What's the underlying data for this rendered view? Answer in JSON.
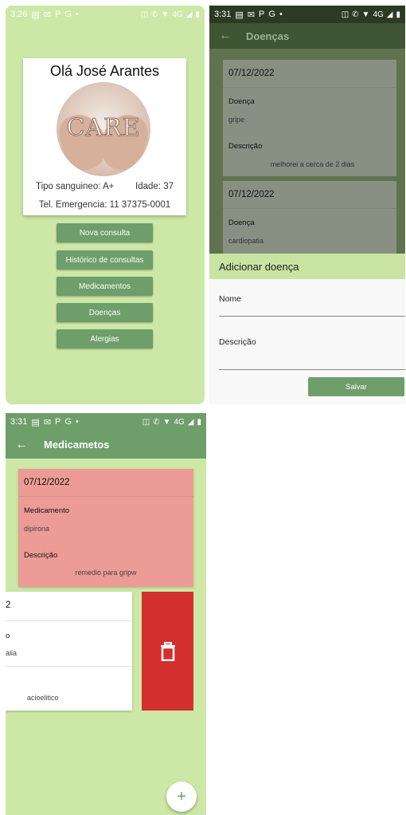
{
  "status": {
    "p1_time": "3:26",
    "p2_time": "3:31",
    "p3_time": "3:31",
    "icons_left": [
      "sim-icon",
      "mail-icon",
      "p-icon",
      "g-icon",
      "dot-icon"
    ],
    "icons_right": [
      "vibrate-icon",
      "call-icon",
      "wifi-icon",
      "signal-icon",
      "battery-icon"
    ],
    "network": "4G"
  },
  "home": {
    "greeting": "Olá José Arantes",
    "logo_text": "CARE",
    "blood_type": "Tipo sanguineo: A+",
    "age": "Idade: 37",
    "emergency_phone": "Tel. Emergencia: 11 37375-0001",
    "buttons": [
      "Nova consulta",
      "Histórico de consultas",
      "Medicamentos",
      "Doenças",
      "Alergias"
    ]
  },
  "doencas": {
    "title": "Doenças",
    "cards": [
      {
        "date": "07/12/2022",
        "label_name": "Doença",
        "name": "gripe",
        "label_desc": "Descrição",
        "desc": "melhorei a cerca de 2 dias"
      },
      {
        "date": "07/12/2022",
        "label_name": "Doença",
        "name": "cardiopatia"
      }
    ],
    "sheet": {
      "title": "Adicionar doença",
      "name_label": "Nome",
      "desc_label": "Descrição",
      "save_label": "Salvar"
    }
  },
  "medicamentos": {
    "title": "Medicametos",
    "card": {
      "date": "07/12/2022",
      "label_name": "Medicamento",
      "name": "dipirona",
      "label_desc": "Descrição",
      "desc": "remedio para gripw"
    },
    "swiped_card": {
      "date_fragment": "2",
      "label_fragment": "o",
      "value_fragment": "alia",
      "desc_fragment": "acioelitico"
    },
    "fab_label": "+"
  },
  "colors": {
    "primary": "#6e9e6a",
    "background": "#cde8a6",
    "card_red": "#ec9b96",
    "delete_red": "#d32f2f"
  }
}
